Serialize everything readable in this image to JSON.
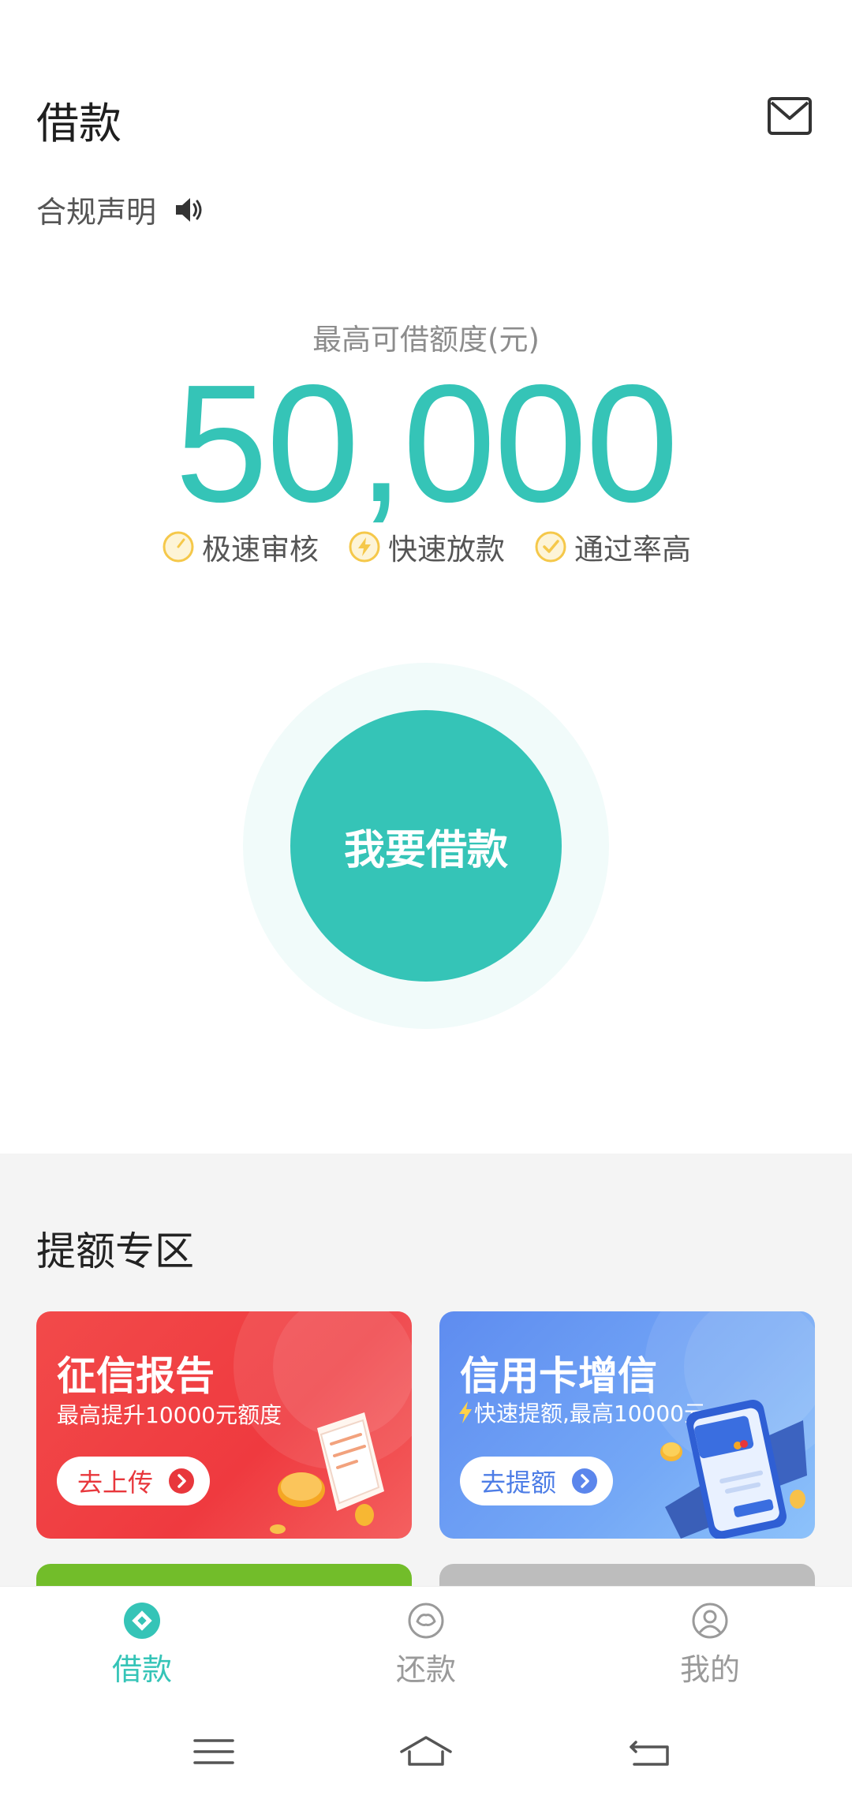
{
  "header": {
    "title": "借款",
    "notice_label": "合规声明"
  },
  "limit": {
    "label": "最高可借额度(元)",
    "amount": "50,000",
    "features": [
      "极速审核",
      "快速放款",
      "通过率高"
    ]
  },
  "primary_button": "我要借款",
  "promo": {
    "title": "提额专区",
    "cards": [
      {
        "title": "征信报告",
        "subtitle": "最高提升10000元额度",
        "button": "去上传"
      },
      {
        "title": "信用卡增信",
        "subtitle": "快速提额,最高10000元",
        "button": "去提额"
      }
    ]
  },
  "bottom_nav": {
    "tabs": [
      "借款",
      "还款",
      "我的"
    ],
    "active": "借款"
  },
  "colors": {
    "accent": "#35c4b7",
    "card_red": "#ef3a3f",
    "card_blue": "#6a9bf3",
    "feature_icon": "#f5c84a"
  },
  "icons": {
    "mail": "mail-icon",
    "speaker": "speaker-icon",
    "system_nav": [
      "menu-icon",
      "home-icon",
      "back-icon"
    ]
  }
}
